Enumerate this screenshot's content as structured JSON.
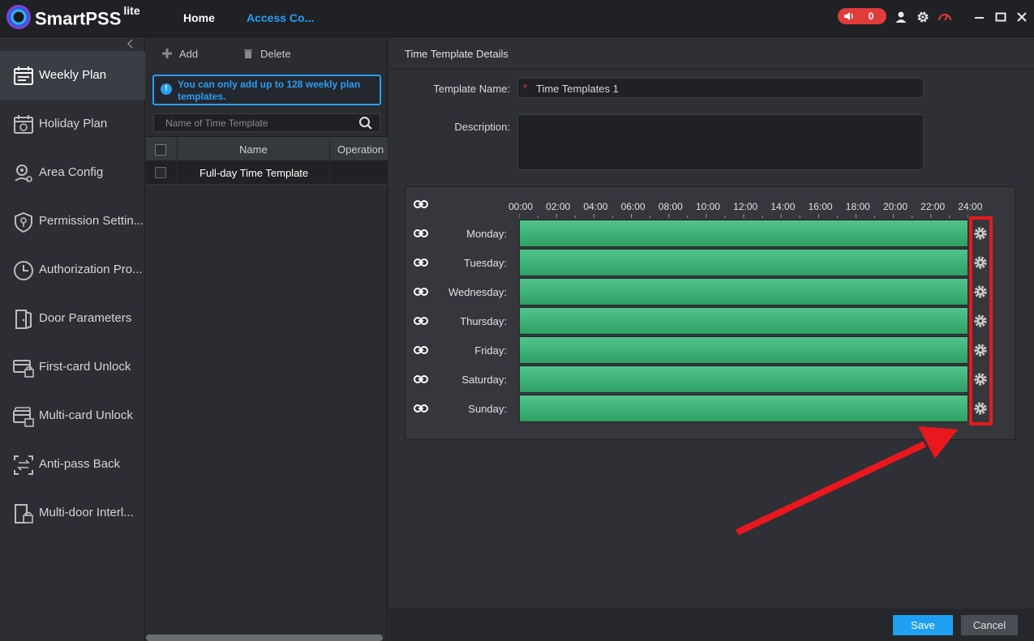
{
  "app": {
    "brand": "SmartPSS",
    "brand_sup": "lite"
  },
  "topnav": {
    "home": "Home",
    "access": "Access Co..."
  },
  "alarm": {
    "count": "0"
  },
  "sidebar": {
    "items": [
      {
        "label": "Weekly Plan",
        "icon": "calendar-icon",
        "active": true
      },
      {
        "label": "Holiday Plan",
        "icon": "holiday-calendar-icon"
      },
      {
        "label": "Area Config",
        "icon": "area-pin-icon"
      },
      {
        "label": "Permission Settin...",
        "icon": "shield-key-icon"
      },
      {
        "label": "Authorization Pro...",
        "icon": "clock-icon"
      },
      {
        "label": "Door Parameters",
        "icon": "door-icon"
      },
      {
        "label": "First-card Unlock",
        "icon": "card-lock-icon"
      },
      {
        "label": "Multi-card Unlock",
        "icon": "multi-card-lock-icon"
      },
      {
        "label": "Anti-pass Back",
        "icon": "anti-pass-icon"
      },
      {
        "label": "Multi-door Interl...",
        "icon": "multi-door-lock-icon"
      }
    ]
  },
  "list": {
    "add": "Add",
    "delete": "Delete",
    "notice": "You can only add up to 128 weekly plan templates.",
    "search_placeholder": "Name of Time Template",
    "col_name": "Name",
    "col_operation": "Operation",
    "rows": [
      {
        "name": "Full-day Time Template"
      }
    ]
  },
  "detail": {
    "title": "Time Template Details",
    "template_name_label": "Template Name:",
    "template_name_value": "Time Templates 1",
    "required_mark": "*",
    "description_label": "Description:",
    "ticks": [
      "00:00",
      "02:00",
      "04:00",
      "06:00",
      "08:00",
      "10:00",
      "12:00",
      "14:00",
      "16:00",
      "18:00",
      "20:00",
      "22:00",
      "24:00"
    ],
    "days": [
      "Monday:",
      "Tuesday:",
      "Wednesday:",
      "Thursday:",
      "Friday:",
      "Saturday:",
      "Sunday:"
    ],
    "save": "Save",
    "cancel": "Cancel"
  },
  "colors": {
    "accent": "#2a9df4",
    "schedule_green": "#3fb477",
    "highlight_red": "#e8181e"
  }
}
